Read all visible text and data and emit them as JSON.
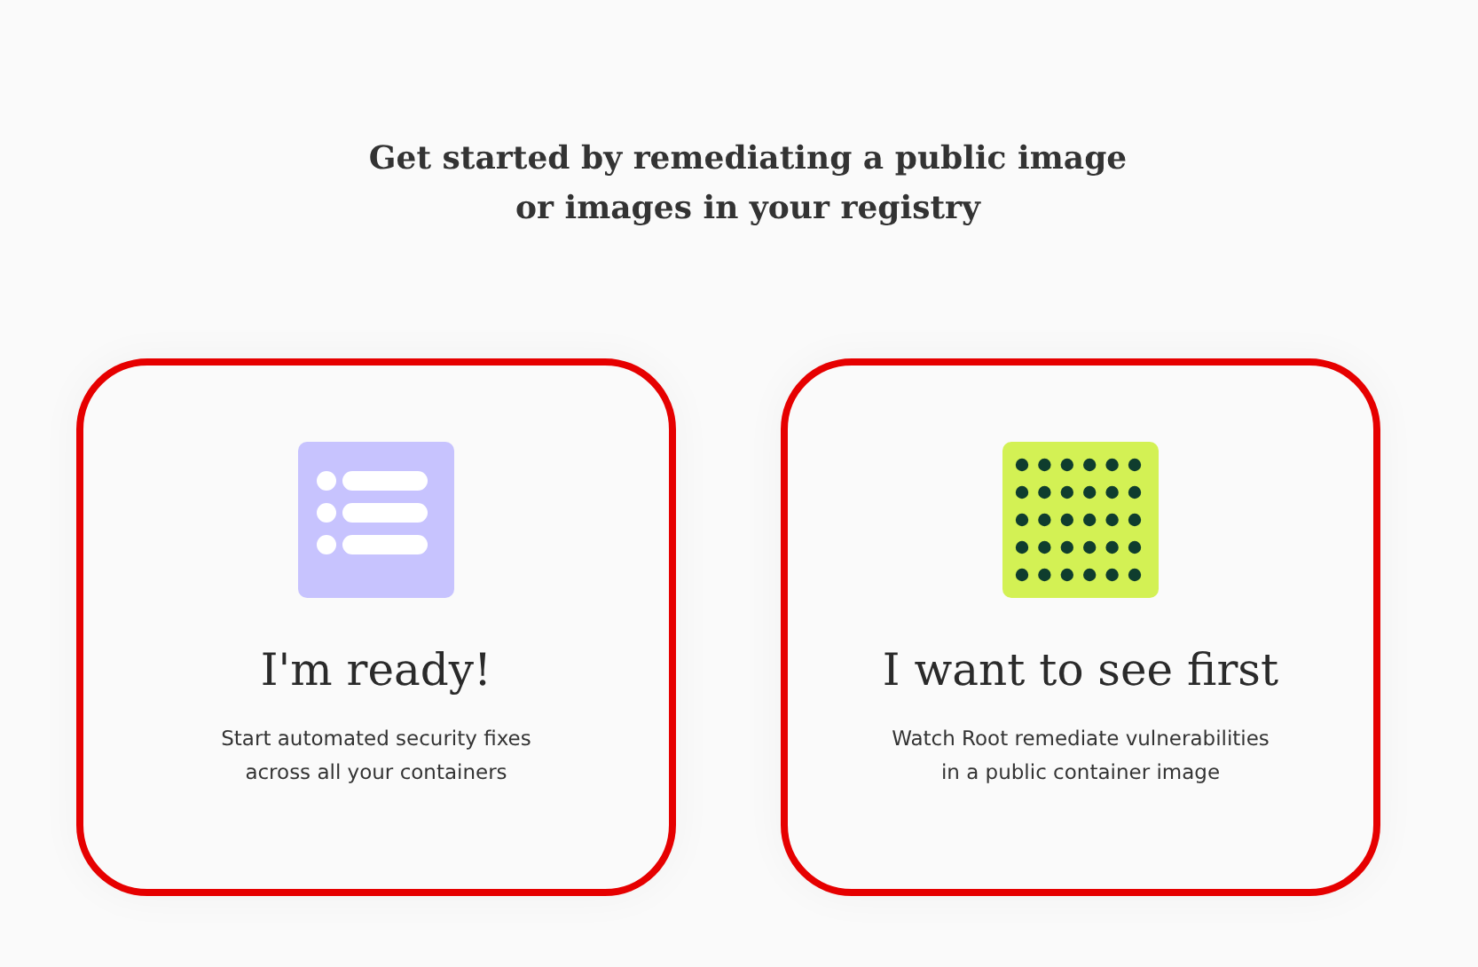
{
  "heading": [
    "Get started by remediating a public image",
    "or images in your registry"
  ],
  "cards": [
    {
      "kind": "list",
      "title": "I'm ready!",
      "description": [
        "Start automated security fixes",
        "across all your containers"
      ],
      "outlined": true
    },
    {
      "kind": "dots",
      "title": "I want to see first",
      "description": [
        "Watch Root remediate vulnerabilities",
        "in a public container image"
      ],
      "outlined": true
    }
  ]
}
